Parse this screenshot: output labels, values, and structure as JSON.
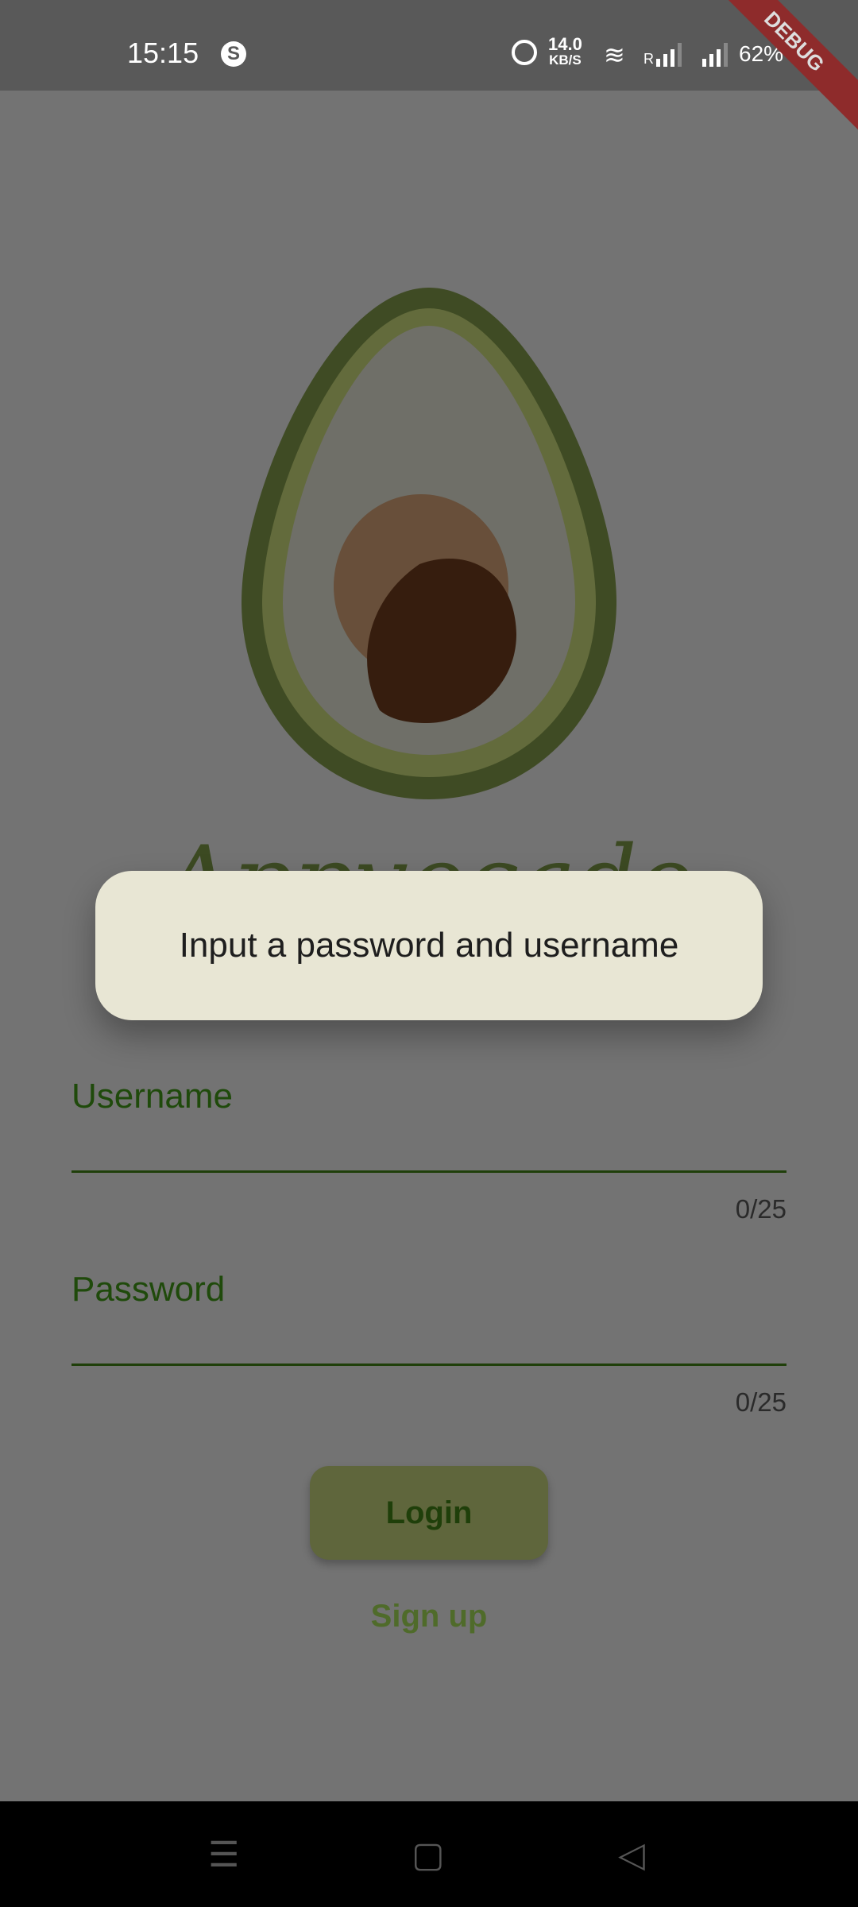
{
  "status_bar": {
    "time": "15:15",
    "app_icon": "S",
    "speed_value": "14.0",
    "speed_unit": "KB/S",
    "roaming": "R",
    "battery": "62%"
  },
  "debug_banner": "DEBUG",
  "app": {
    "title": "Appvocado"
  },
  "dialog": {
    "message": "Input a password and username"
  },
  "form": {
    "username": {
      "label": "Username",
      "counter": "0/25"
    },
    "password": {
      "label": "Password",
      "counter": "0/25"
    },
    "login_label": "Login",
    "signup_label": "Sign up"
  },
  "nav": {
    "menu": "☰",
    "home": "▢",
    "back": "◁"
  }
}
